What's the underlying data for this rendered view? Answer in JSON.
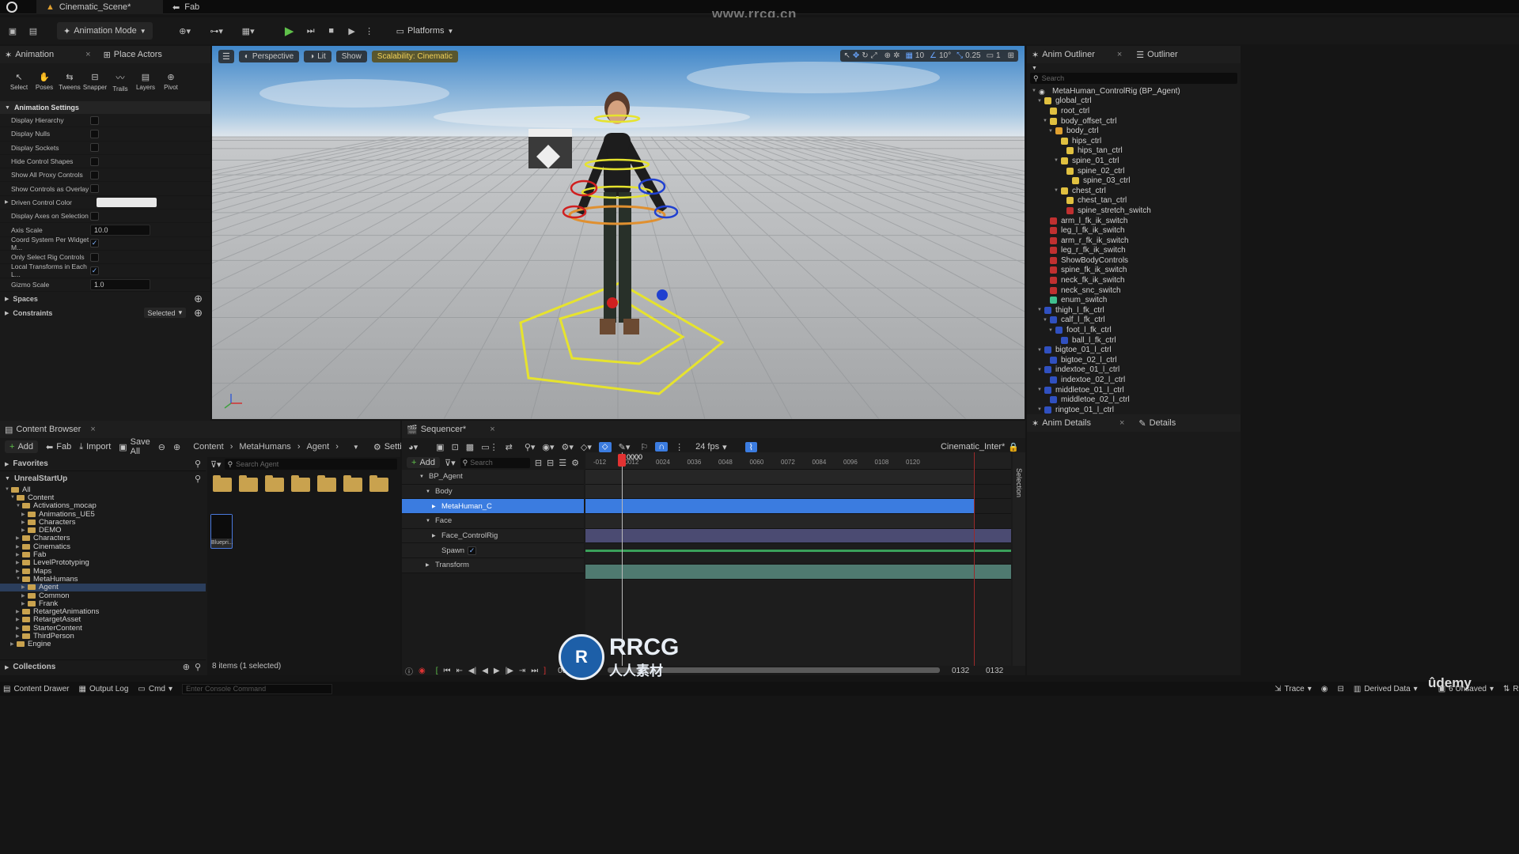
{
  "window": {
    "tab_scene": "Cinematic_Scene*",
    "tab_fab": "Fab",
    "watermark_top": "www.rrcg.cn"
  },
  "toolbar": {
    "mode": "Animation Mode",
    "platforms": "Platforms"
  },
  "left_panel": {
    "tab_animation": "Animation",
    "tab_place": "Place Actors",
    "tools": [
      "Select",
      "Poses",
      "Tweens",
      "Snapper",
      "Trails",
      "Layers",
      "Pivot"
    ],
    "section_title": "Animation Settings",
    "settings": [
      {
        "label": "Display Hierarchy",
        "type": "check",
        "checked": false
      },
      {
        "label": "Display Nulls",
        "type": "check",
        "checked": false
      },
      {
        "label": "Display Sockets",
        "type": "check",
        "checked": false
      },
      {
        "label": "Hide Control Shapes",
        "type": "check",
        "checked": false
      },
      {
        "label": "Show All Proxy Controls",
        "type": "check",
        "checked": false
      },
      {
        "label": "Show Controls as Overlay",
        "type": "check",
        "checked": false
      },
      {
        "label": "Driven Control Color",
        "type": "color"
      },
      {
        "label": "Display Axes on Selection",
        "type": "check",
        "checked": false
      },
      {
        "label": "Axis Scale",
        "type": "value",
        "value": "10.0"
      },
      {
        "label": "Coord System Per Widget M...",
        "type": "check",
        "checked": true
      },
      {
        "label": "Only Select Rig Controls",
        "type": "check",
        "checked": false
      },
      {
        "label": "Local Transforms in Each L...",
        "type": "check",
        "checked": true
      },
      {
        "label": "Gizmo Scale",
        "type": "value",
        "value": "1.0"
      }
    ],
    "spaces": "Spaces",
    "constraints": "Constraints",
    "constraints_value": "Selected"
  },
  "viewport": {
    "perspective": "Perspective",
    "lit": "Lit",
    "show": "Show",
    "scalability": "Scalability: Cinematic",
    "grid": "10",
    "angle": "10°",
    "scale": "0.25",
    "cam": "1"
  },
  "outliner": {
    "tab_anim": "Anim Outliner",
    "tab_outliner": "Outliner",
    "search": "Search",
    "items": [
      {
        "label": "MetaHuman_ControlRig (BP_Agent)",
        "indent": 0,
        "color": "#888888"
      },
      {
        "label": "global_ctrl",
        "indent": 1,
        "color": "#e0c040"
      },
      {
        "label": "root_ctrl",
        "indent": 2,
        "color": "#e0c040"
      },
      {
        "label": "body_offset_ctrl",
        "indent": 2,
        "color": "#e0c040"
      },
      {
        "label": "body_ctrl",
        "indent": 3,
        "color": "#e0a030"
      },
      {
        "label": "hips_ctrl",
        "indent": 4,
        "color": "#e0c040"
      },
      {
        "label": "hips_tan_ctrl",
        "indent": 5,
        "color": "#e0c040"
      },
      {
        "label": "spine_01_ctrl",
        "indent": 4,
        "color": "#e0c040"
      },
      {
        "label": "spine_02_ctrl",
        "indent": 5,
        "color": "#e0c040"
      },
      {
        "label": "spine_03_ctrl",
        "indent": 6,
        "color": "#e0c040"
      },
      {
        "label": "chest_ctrl",
        "indent": 4,
        "color": "#e0c040"
      },
      {
        "label": "chest_tan_ctrl",
        "indent": 5,
        "color": "#e0c040"
      },
      {
        "label": "spine_stretch_switch",
        "indent": 5,
        "color": "#c03030"
      },
      {
        "label": "arm_l_fk_ik_switch",
        "indent": 2,
        "color": "#c03030"
      },
      {
        "label": "leg_l_fk_ik_switch",
        "indent": 2,
        "color": "#c03030"
      },
      {
        "label": "arm_r_fk_ik_switch",
        "indent": 2,
        "color": "#c03030"
      },
      {
        "label": "leg_r_fk_ik_switch",
        "indent": 2,
        "color": "#c03030"
      },
      {
        "label": "ShowBodyControls",
        "indent": 2,
        "color": "#c03030"
      },
      {
        "label": "spine_fk_ik_switch",
        "indent": 2,
        "color": "#c03030"
      },
      {
        "label": "neck_fk_ik_switch",
        "indent": 2,
        "color": "#c03030"
      },
      {
        "label": "neck_snc_switch",
        "indent": 2,
        "color": "#c03030"
      },
      {
        "label": "enum_switch",
        "indent": 2,
        "color": "#40c090"
      },
      {
        "label": "thigh_l_fk_ctrl",
        "indent": 1,
        "color": "#3050c0"
      },
      {
        "label": "calf_l_fk_ctrl",
        "indent": 2,
        "color": "#3050c0"
      },
      {
        "label": "foot_l_fk_ctrl",
        "indent": 3,
        "color": "#3050c0"
      },
      {
        "label": "ball_l_fk_ctrl",
        "indent": 4,
        "color": "#3050c0"
      },
      {
        "label": "bigtoe_01_l_ctrl",
        "indent": 1,
        "color": "#3050c0"
      },
      {
        "label": "bigtoe_02_l_ctrl",
        "indent": 2,
        "color": "#3050c0"
      },
      {
        "label": "indextoe_01_l_ctrl",
        "indent": 1,
        "color": "#3050c0"
      },
      {
        "label": "indextoe_02_l_ctrl",
        "indent": 2,
        "color": "#3050c0"
      },
      {
        "label": "middletoe_01_l_ctrl",
        "indent": 1,
        "color": "#3050c0"
      },
      {
        "label": "middletoe_02_l_ctrl",
        "indent": 2,
        "color": "#3050c0"
      },
      {
        "label": "ringtoe_01_l_ctrl",
        "indent": 1,
        "color": "#3050c0"
      }
    ]
  },
  "details": {
    "tab_anim": "Anim Details",
    "tab_details": "Details"
  },
  "content_browser": {
    "tab": "Content Browser",
    "add": "Add",
    "fab": "Fab",
    "import": "Import",
    "save_all": "Save All",
    "breadcrumb": [
      "Content",
      "MetaHumans",
      "Agent"
    ],
    "settings": "Settings",
    "favorites": "Favorites",
    "project": "UnrealStartUp",
    "search_placeholder": "Search Agent",
    "tree": [
      {
        "label": "All",
        "indent": 0
      },
      {
        "label": "Content",
        "indent": 1
      },
      {
        "label": "Activations_mocap",
        "indent": 2
      },
      {
        "label": "Animations_UE5",
        "indent": 3
      },
      {
        "label": "Characters",
        "indent": 3
      },
      {
        "label": "DEMO",
        "indent": 3
      },
      {
        "label": "Characters",
        "indent": 2
      },
      {
        "label": "Cinematics",
        "indent": 2
      },
      {
        "label": "Fab",
        "indent": 2
      },
      {
        "label": "LevelPrototyping",
        "indent": 2
      },
      {
        "label": "Maps",
        "indent": 2
      },
      {
        "label": "MetaHumans",
        "indent": 2
      },
      {
        "label": "Agent",
        "indent": 3,
        "selected": true
      },
      {
        "label": "Common",
        "indent": 3
      },
      {
        "label": "Frank",
        "indent": 3
      },
      {
        "label": "RetargetAnimations",
        "indent": 2
      },
      {
        "label": "RetargetAsset",
        "indent": 2
      },
      {
        "label": "StarterContent",
        "indent": 2
      },
      {
        "label": "ThirdPerson",
        "indent": 2
      },
      {
        "label": "Engine",
        "indent": 1
      }
    ],
    "asset_label": "Bluepri...",
    "status": "8 items (1 selected)",
    "collections": "Collections"
  },
  "sequencer": {
    "tab": "Sequencer*",
    "fps": "24 fps",
    "sequence_name": "Cinematic_Inter*",
    "add": "Add",
    "search": "Search",
    "current_frame": "0000",
    "ruler": [
      "-012",
      "0012",
      "0024",
      "0036",
      "0048",
      "0060",
      "0072",
      "0084",
      "0096",
      "0108",
      "0120"
    ],
    "tracks": [
      {
        "label": "BP_Agent",
        "indent": 0
      },
      {
        "label": "Body",
        "indent": 1
      },
      {
        "label": "MetaHuman_C",
        "indent": 2,
        "selected": true
      },
      {
        "label": "Face",
        "indent": 1
      },
      {
        "label": "Face_ControlRig",
        "indent": 2
      },
      {
        "label": "Spawn",
        "indent": 2,
        "checkbox": true
      },
      {
        "label": "Transform",
        "indent": 1
      }
    ],
    "end_frame_a": "0132",
    "end_frame_b": "0132",
    "start_frame": "0000",
    "sidebar": "Selection"
  },
  "statusbar": {
    "drawer": "Content Drawer",
    "output": "Output Log",
    "cmd": "Cmd",
    "console_placeholder": "Enter Console Command",
    "trace": "Trace",
    "derived": "Derived Data",
    "unsaved": "6 Unsaved",
    "rev": "Re"
  },
  "watermark": {
    "brand": "RRCG",
    "brand_sub": "人人素材",
    "udemy": "ûdemy"
  }
}
